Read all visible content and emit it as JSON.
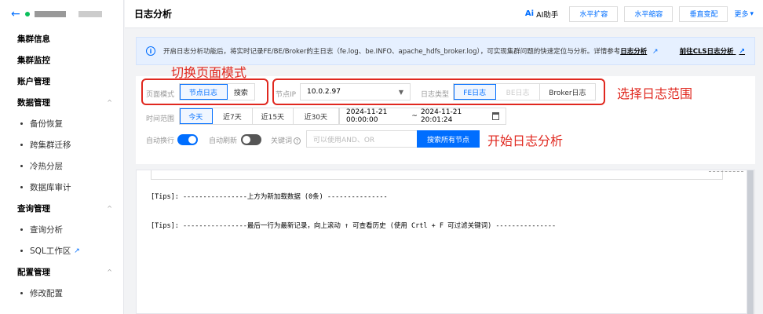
{
  "sidebar": {
    "items": [
      {
        "label": "集群信息",
        "type": "top"
      },
      {
        "label": "集群监控",
        "type": "top"
      },
      {
        "label": "账户管理",
        "type": "top"
      },
      {
        "label": "数据管理",
        "type": "group"
      },
      {
        "label": "备份恢复",
        "type": "sub"
      },
      {
        "label": "跨集群迁移",
        "type": "sub"
      },
      {
        "label": "冷热分层",
        "type": "sub"
      },
      {
        "label": "数据库审计",
        "type": "sub"
      },
      {
        "label": "查询管理",
        "type": "group"
      },
      {
        "label": "查询分析",
        "type": "sub"
      },
      {
        "label": "SQL工作区",
        "type": "sub"
      },
      {
        "label": "配置管理",
        "type": "group"
      },
      {
        "label": "修改配置",
        "type": "sub"
      }
    ]
  },
  "header": {
    "title": "日志分析",
    "ai_label": "AI助手",
    "buttons": [
      "水平扩容",
      "水平缩容",
      "垂直变配"
    ],
    "more_label": "更多"
  },
  "banner": {
    "text": "开启日志分析功能后，将实时记录FE/BE/Broker的主日志（fe.log、be.INFO、apache_hdfs_broker.log），可实现集群问题的快速定位与分析。详情参考",
    "link1": "日志分析",
    "link2": "前往CLS日志分析"
  },
  "annotations": {
    "mode": "切换页面模式",
    "range": "选择日志范围",
    "start": "开始日志分析"
  },
  "filters": {
    "page_mode_label": "页面模式",
    "page_mode_options": [
      "节点日志",
      "搜索"
    ],
    "node_ip_label": "节点IP",
    "node_ip_value": "10.0.2.97",
    "log_type_label": "日志类型",
    "log_type_options": [
      "FE日志",
      "BE日志",
      "Broker日志"
    ],
    "time_range_label": "时间范围",
    "time_options": [
      "今天",
      "近7天",
      "近15天",
      "近30天"
    ],
    "date_start": "2024-11-21 00:00:00",
    "date_sep": "~",
    "date_end": "2024-11-21 20:01:24",
    "auto_wrap_label": "自动换行",
    "auto_refresh_label": "自动刷新",
    "keyword_label": "关键词",
    "keyword_placeholder": "可以使用AND、OR",
    "search_all_label": "搜索所有节点"
  },
  "log": {
    "line1": "[Tips]: ----------------上方为新加载数据 (0条) ---------------",
    "line2": "[Tips]: ----------------最后一行为最新记录，向上滚动 ↑ 可查看历史 (使用 Crtl + F 可过滤关键词) ---------------"
  },
  "colors": {
    "accent": "#006eff",
    "annotation": "#e0281f",
    "status": "#0abf5b"
  }
}
